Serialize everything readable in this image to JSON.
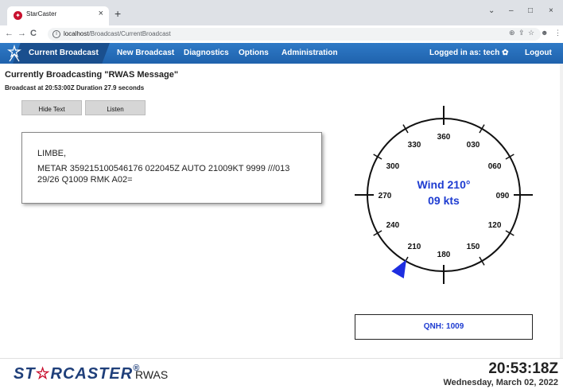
{
  "browser": {
    "tab_title": "StarCaster",
    "tab_close": "×",
    "new_tab": "+",
    "url_host": "localhost",
    "url_path": "/Broadcast/CurrentBroadcast",
    "window_controls": [
      "⌄",
      "–",
      "□",
      "×"
    ],
    "nav": [
      "←",
      "→",
      "C"
    ],
    "addr_icons": [
      "⊕",
      "⇪",
      "☆",
      "☻",
      "⋮"
    ]
  },
  "nav": {
    "items": [
      "Current Broadcast",
      "New Broadcast",
      "Diagnostics",
      "Options",
      "Administration"
    ],
    "active_index": 0,
    "user_label": "Logged in as: tech ✿",
    "logout": "Logout"
  },
  "broadcast": {
    "title": "Currently Broadcasting \"RWAS Message\"",
    "subtitle": "Broadcast at 20:53:00Z Duration 27.9 seconds",
    "hide_text_button": "Hide Text",
    "listen_button": "Listen",
    "station": "LIMBE,",
    "message": "METAR 359215100546176 022045Z AUTO 21009KT 9999 ///013 29/26 Q1009 RMK A02="
  },
  "compass": {
    "labels": [
      "360",
      "030",
      "060",
      "090",
      "120",
      "150",
      "180",
      "210",
      "240",
      "270",
      "300",
      "330"
    ],
    "wind_direction_deg": 210,
    "wind_line1": "Wind 210°",
    "wind_line2": "09 kts",
    "pointer_color": "#1e2ee0",
    "text_color": "#1e3cd1"
  },
  "qnh": {
    "label": "QNH: 1009"
  },
  "footer": {
    "brand_left": "ST",
    "brand_star": "☆",
    "brand_right": "RCASTER",
    "brand_reg": "®",
    "app_name": "RWAS",
    "time": "20:53:18Z",
    "date": "Wednesday, March 02, 2022"
  },
  "colors": {
    "nav_blue": "#2a6fbd",
    "brand_blue": "#1f3f7a",
    "brand_red": "#c8102e"
  }
}
